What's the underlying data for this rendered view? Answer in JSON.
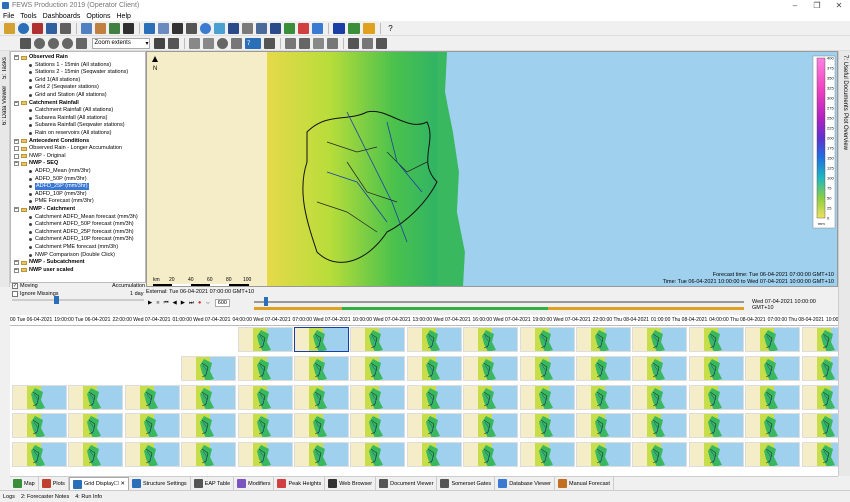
{
  "window": {
    "title": "FEWS Production 2019  (Operator Client)",
    "controls": [
      "–",
      "❐",
      "✕"
    ]
  },
  "menu": [
    "File",
    "Tools",
    "Dashboards",
    "Options",
    "Help"
  ],
  "toolbar2": {
    "zoom_label": "Zoom extents",
    "step_value": "7"
  },
  "left_tabs": [
    "5: Tasks",
    "6: Data Viewer"
  ],
  "right_tabs": [
    "7: Useful Documents",
    "Plot Overview"
  ],
  "tree": [
    {
      "label": "Observed Rain",
      "level": 0,
      "type": "folder"
    },
    {
      "label": "Stations 1 - 15min (All stations)",
      "level": 1,
      "type": "item"
    },
    {
      "label": "Stations 2 - 15min (Seqwater stations)",
      "level": 1,
      "type": "item"
    },
    {
      "label": "Grid 1(All stations)",
      "level": 1,
      "type": "item"
    },
    {
      "label": "Grid 2 (Seqwater stations)",
      "level": 1,
      "type": "item"
    },
    {
      "label": "Grid and Station (All stations)",
      "level": 1,
      "type": "item"
    },
    {
      "label": "Catchment Rainfall",
      "level": 0,
      "type": "folder"
    },
    {
      "label": "Catchment Rainfall (All stations)",
      "level": 1,
      "type": "item"
    },
    {
      "label": "Subarea Rainfall (All stations)",
      "level": 1,
      "type": "item"
    },
    {
      "label": "Subarea Rainfall (Seqwater stations)",
      "level": 1,
      "type": "item"
    },
    {
      "label": "Rain on reservoirs (All stations)",
      "level": 1,
      "type": "item"
    },
    {
      "label": "Antecedent Conditions",
      "level": 0,
      "type": "folder"
    },
    {
      "label": "Observed Rain - Longer Accumulation",
      "level": 0,
      "type": "plain"
    },
    {
      "label": "NWP - Original",
      "level": 0,
      "type": "plain"
    },
    {
      "label": "NWP - SEQ",
      "level": 0,
      "type": "folder"
    },
    {
      "label": "ADFD_Mean (mm/3hr)",
      "level": 1,
      "type": "item"
    },
    {
      "label": "ADFD_50P (mm/3hr)",
      "level": 1,
      "type": "item"
    },
    {
      "label": "ADFD_25P (mm/3hr)",
      "level": 1,
      "type": "item",
      "selected": true
    },
    {
      "label": "ADFD_10P (mm/3hr)",
      "level": 1,
      "type": "item"
    },
    {
      "label": "PME Forecast (mm/3hr)",
      "level": 1,
      "type": "item"
    },
    {
      "label": "NWP - Catchment",
      "level": 0,
      "type": "folder"
    },
    {
      "label": "Catchment ADFD_Mean forecast (mm/3h)",
      "level": 1,
      "type": "item"
    },
    {
      "label": "Catchment ADFD_50P forecast (mm/3h)",
      "level": 1,
      "type": "item"
    },
    {
      "label": "Catchment ADFD_25P forecast (mm/3h)",
      "level": 1,
      "type": "item"
    },
    {
      "label": "Catchment ADFD_10P forecast (mm/3h)",
      "level": 1,
      "type": "item"
    },
    {
      "label": "Catchment PME forecast (mm/3h)",
      "level": 1,
      "type": "item"
    },
    {
      "label": "NWP Comparison (Double Click)",
      "level": 1,
      "type": "item"
    },
    {
      "label": "NWP - Subcatchment",
      "level": 0,
      "type": "folder"
    },
    {
      "label": "NWP user scaled",
      "level": 0,
      "type": "folder"
    }
  ],
  "tree_options": {
    "moving_label": "Moving",
    "moving_checked": true,
    "ignore_missings_label": "Ignore Missings",
    "ignore_missings_checked": false,
    "accumulation_label": "Accumulation",
    "accumulation_value": "1 day"
  },
  "map": {
    "legend_ticks": [
      "400",
      "375",
      "350",
      "325",
      "300",
      "275",
      "250",
      "225",
      "200",
      "175",
      "150",
      "125",
      "100",
      "75",
      "50",
      "25",
      "0"
    ],
    "legend_unit": "mm",
    "scale_label": "km",
    "scale_ticks": [
      "20",
      "40",
      "60",
      "80",
      "100"
    ],
    "forecast_time": "Forecast time: Tue 06-04-2021 07:00:00 GMT+10",
    "time": "Time: Tue 06-04-2021 10:00:00 to Wed 07-04-2021 10:00:00 GMT+10",
    "north": "N"
  },
  "controls": {
    "external": "External: Tue 06-04-2021 07:00:00 GMT+10",
    "timestamp": "Wed 07-04-2021 10:00:00 GMT+10",
    "speed": "600"
  },
  "time_axis": [
    "00 Tue 06-04-2021",
    "19:00:00 Tue 06-04-2021",
    "22:00:00 Wed 07-04-2021",
    "01:00:00 Wed 07-04-2021",
    "04:00:00 Wed 07-04-2021",
    "07:00:00 Wed 07-04-2021",
    "10:00:00 Wed 07-04-2021",
    "13:00:00 Wed 07-04-2021",
    "16:00:00 Wed 07-04-2021",
    "19:00:00 Wed 07-04-2021",
    "22:00:00 Thu 08-04-2021",
    "01:00:00 Thu 08-04-2021",
    "04:00:00 Thu 08-04-2021",
    "07:00:00 Thu 08-04-2021",
    "10:00:00 Thu 08-04-2021",
    "13:00:00 Thu 0"
  ],
  "grid_rows": [
    {
      "start": 4,
      "count": 11
    },
    {
      "start": 3,
      "count": 12
    },
    {
      "start": 0,
      "count": 15
    },
    {
      "start": 0,
      "count": 15
    },
    {
      "start": 0,
      "count": 15
    }
  ],
  "bottom_tabs": [
    {
      "label": "Map",
      "color": "#3a8f3a"
    },
    {
      "label": "Plots",
      "color": "#c04030"
    },
    {
      "label": "Grid Display",
      "color": "#2a6fb8",
      "active": true
    },
    {
      "label": "Structure Settings",
      "color": "#2a6fb8"
    },
    {
      "label": "EAP Table",
      "color": "#555555"
    },
    {
      "label": "Modifiers",
      "color": "#7a55c0"
    },
    {
      "label": "Peak Heights",
      "color": "#d04040"
    },
    {
      "label": "Web Browser",
      "color": "#333333"
    },
    {
      "label": "Document Viewer",
      "color": "#555555"
    },
    {
      "label": "Somerset Gates",
      "color": "#555555"
    },
    {
      "label": "Database Viewer",
      "color": "#3a7ad0"
    },
    {
      "label": "Manual Forecast",
      "color": "#c07020"
    }
  ],
  "status": [
    "Logs",
    "2: Forecaster Notes",
    "4: Run Info"
  ]
}
